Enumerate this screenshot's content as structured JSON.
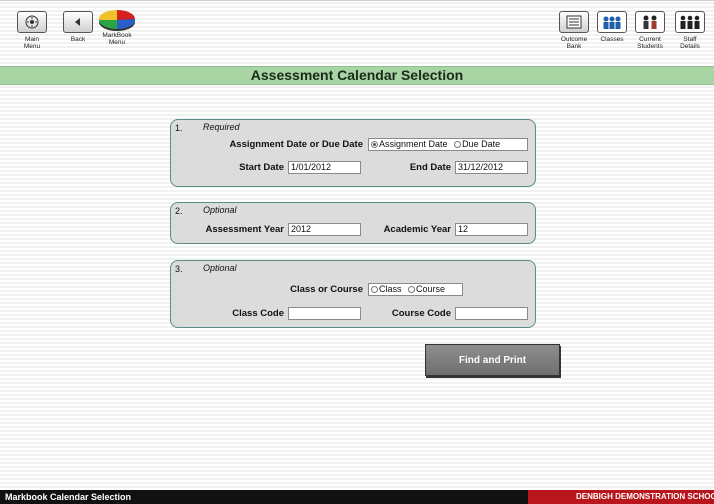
{
  "toolbar": {
    "left": [
      {
        "label": "Main\nMenu",
        "icon": "main-menu-icon"
      },
      {
        "label": "Back",
        "icon": "back-arrow-icon"
      },
      {
        "label": "MarkBook\nMenu",
        "icon": "pie-chart-icon"
      }
    ],
    "right": [
      {
        "label": "Outcome\nBank",
        "icon": "outcome-bank-icon"
      },
      {
        "label": "Classes",
        "icon": "classes-icon"
      },
      {
        "label": "Current\nStudents",
        "icon": "current-students-icon"
      },
      {
        "label": "Staff\nDetails",
        "icon": "staff-details-icon"
      }
    ]
  },
  "title": "Assessment Calendar Selection",
  "section1": {
    "number": "1.",
    "heading": "Required",
    "assignment_or_due_label": "Assignment Date or Due Date",
    "option_assignment": "Assignment Date",
    "option_due": "Due Date",
    "selected": "Assignment Date",
    "start_date_label": "Start Date",
    "start_date_value": "1/01/2012",
    "end_date_label": "End Date",
    "end_date_value": "31/12/2012"
  },
  "section2": {
    "number": "2.",
    "heading": "Optional",
    "assessment_year_label": "Assessment Year",
    "assessment_year_value": "2012",
    "academic_year_label": "Academic Year",
    "academic_year_value": "12"
  },
  "section3": {
    "number": "3.",
    "heading": "Optional",
    "class_or_course_label": "Class or Course",
    "option_class": "Class",
    "option_course": "Course",
    "class_code_label": "Class Code",
    "class_code_value": "",
    "course_code_label": "Course Code",
    "course_code_value": ""
  },
  "find_button": "Find and Print",
  "status": {
    "left": "Markbook Calendar Selection",
    "right": "DENBIGH DEMONSTRATION SCHOOL"
  },
  "colors": {
    "title_bar": "#a9d4a4",
    "panel_border": "#5a8c8a",
    "status_red": "#b8161c"
  }
}
